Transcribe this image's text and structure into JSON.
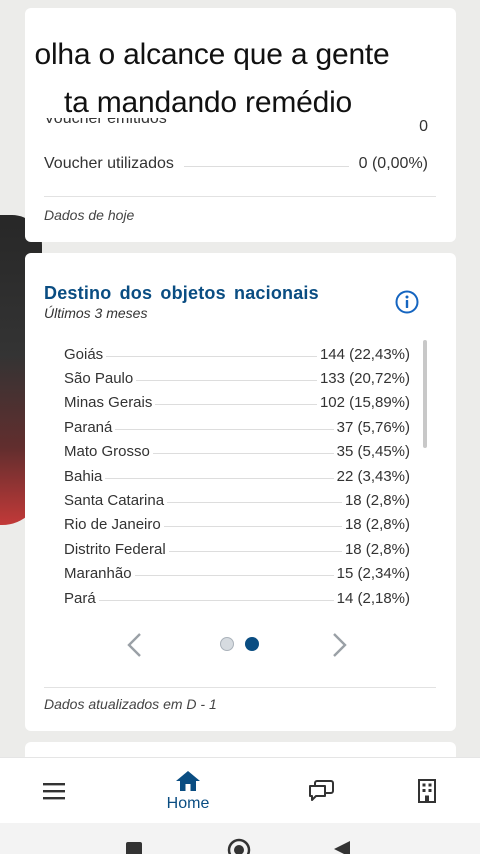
{
  "caption": {
    "line1": "olha o alcance que a gente",
    "line2": "ta mandando remédio"
  },
  "top_card": {
    "emitted_value": "0",
    "used_label": "Voucher utilizados",
    "used_value": "0 (0,00%)",
    "note": "Dados de hoje"
  },
  "destino": {
    "title": "Destino  dos  objetos  nacionais",
    "subtitle": "Últimos 3 meses",
    "items": [
      {
        "name": "Goiás",
        "value": "144 (22,43%)"
      },
      {
        "name": "São Paulo",
        "value": "133 (20,72%)"
      },
      {
        "name": "Minas Gerais",
        "value": "102 (15,89%)"
      },
      {
        "name": "Paraná",
        "value": "37 (5,76%)"
      },
      {
        "name": "Mato Grosso",
        "value": "35 (5,45%)"
      },
      {
        "name": "Bahia",
        "value": "22 (3,43%)"
      },
      {
        "name": "Santa Catarina",
        "value": "18 (2,8%)"
      },
      {
        "name": "Rio de Janeiro",
        "value": "18 (2,8%)"
      },
      {
        "name": "Distrito Federal",
        "value": "18 (2,8%)"
      },
      {
        "name": "Maranhão",
        "value": "15 (2,34%)"
      },
      {
        "name": "Pará",
        "value": "14 (2,18%)"
      }
    ],
    "pager_active_index": 1,
    "footer_note": "Dados atualizados em D - 1"
  },
  "bottom_nav": {
    "home_label": "Home",
    "icons": [
      "menu-icon",
      "home-icon",
      "chat-icon",
      "building-icon"
    ]
  },
  "colors": {
    "accent": "#0a4d82",
    "background": "#ececea"
  }
}
